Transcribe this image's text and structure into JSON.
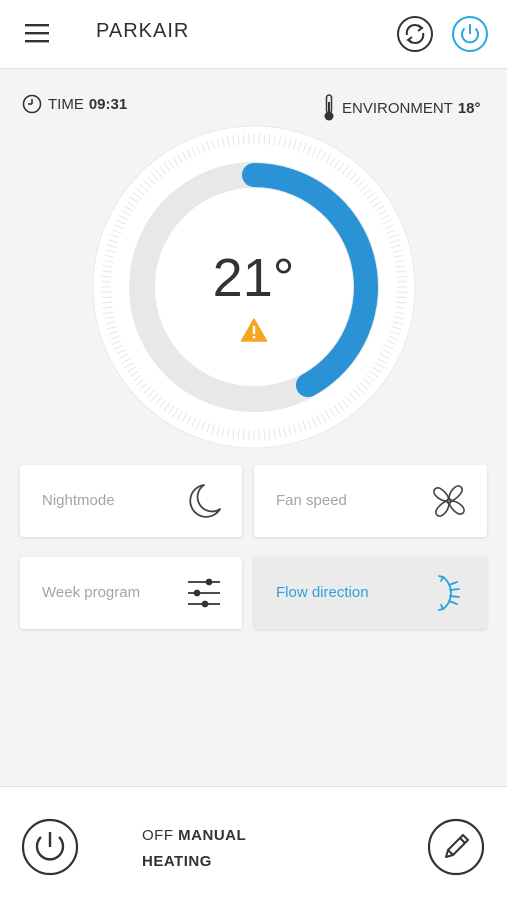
{
  "header": {
    "title": "PARKAIR",
    "menu_icon": "hamburger-menu-icon",
    "sync_icon": "sync-icon",
    "power_icon": "power-icon",
    "accent_color": "#29a8e0"
  },
  "info": {
    "time_label": "TIME",
    "time_value": "09:31",
    "environment_label": "ENVIRONMENT",
    "environment_value": "18°"
  },
  "dial": {
    "temperature": "21°",
    "setpoint_level": 0.42,
    "warning_icon": "warning-icon",
    "arc_color": "#2a93d5",
    "warning_color": "#f5a623"
  },
  "cards": [
    {
      "label": "Nightmode",
      "icon": "moon-icon",
      "active": false
    },
    {
      "label": "Fan speed",
      "icon": "fan-icon",
      "active": false
    },
    {
      "label": "Week program",
      "icon": "sliders-icon",
      "active": false
    },
    {
      "label": "Flow direction",
      "icon": "airflow-icon",
      "active": true
    }
  ],
  "footer": {
    "status_line1_light": "OFF",
    "status_line1_bold": "MANUAL",
    "status_line2": "HEATING",
    "power_icon": "power-icon",
    "edit_icon": "pencil-icon"
  }
}
